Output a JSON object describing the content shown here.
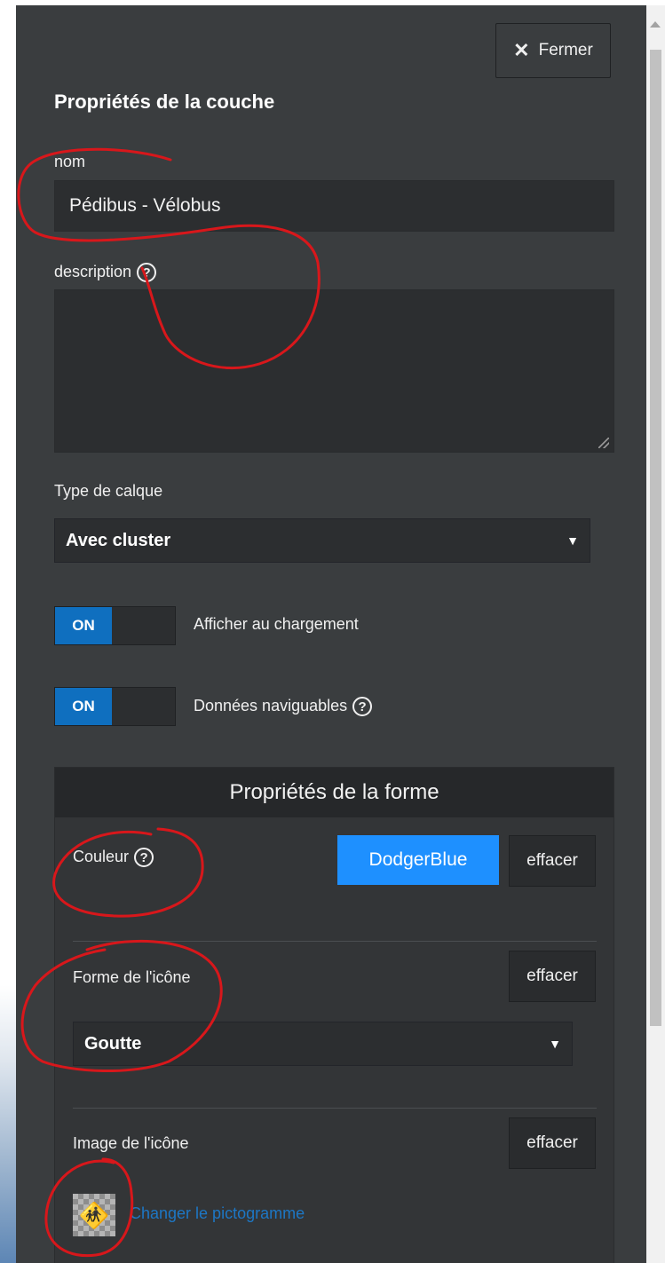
{
  "panel": {
    "close_label": "Fermer",
    "title": "Propriétés de la couche",
    "name_label": "nom",
    "name_value": "Pédibus - Vélobus",
    "description_label": "description",
    "description_value": "",
    "layer_type_label": "Type de calque",
    "layer_type_value": "Avec cluster",
    "toggle_on_text": "ON",
    "show_on_load_label": "Afficher au chargement",
    "navigable_label": "Données naviguables",
    "help_glyph": "?"
  },
  "shape": {
    "header": "Propriétés de la forme",
    "color_label": "Couleur",
    "color_value": "DodgerBlue",
    "clear_label": "effacer",
    "icon_shape_label": "Forme de l'icône",
    "icon_shape_value": "Goutte",
    "icon_image_label": "Image de l'icône",
    "change_picto_label": "Changer le pictogramme"
  },
  "colors": {
    "panel_bg": "#3a3d3f",
    "field_bg": "#2c2e30",
    "toggle_on": "#0f6fbf",
    "dodgerblue": "#1e90ff",
    "annotation": "#d8171b",
    "link": "#1d77c5"
  },
  "icons": {
    "close": "close-icon",
    "help": "help-circle-icon",
    "caret": "caret-down-icon",
    "pictogram": "pedestrians-icon"
  }
}
